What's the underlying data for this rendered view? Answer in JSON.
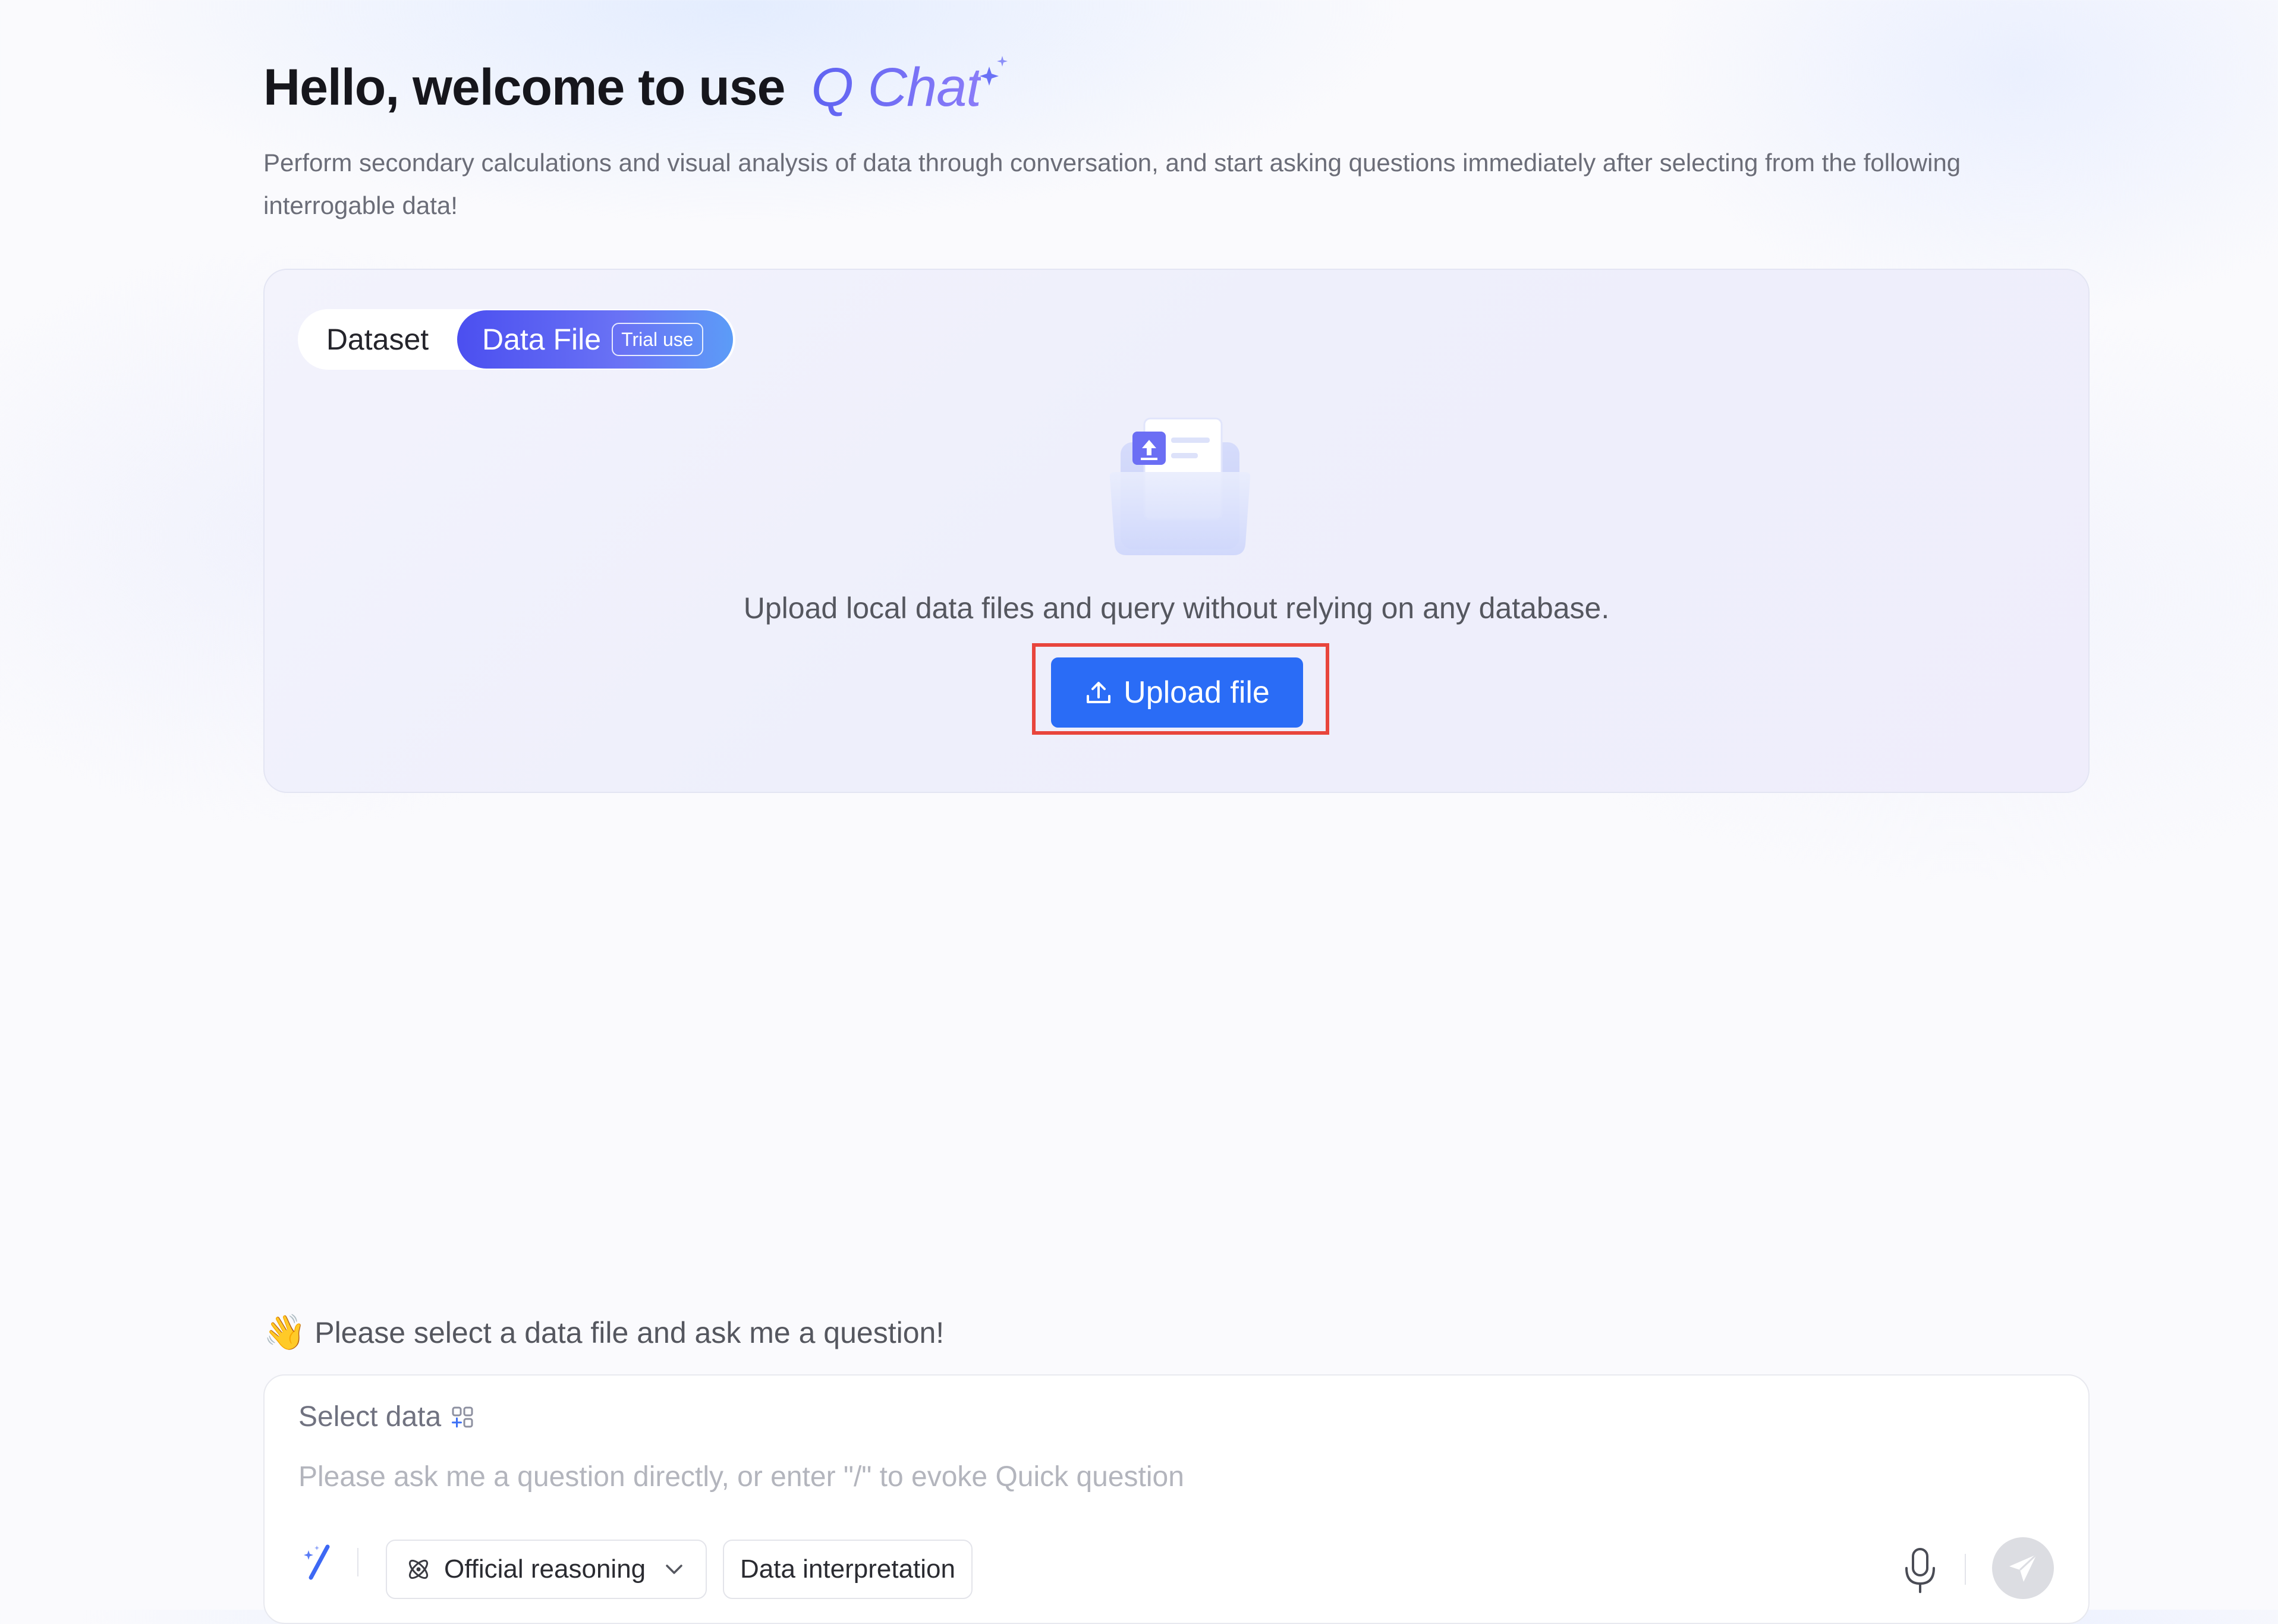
{
  "header": {
    "title": "Hello, welcome to use",
    "brand": "Q Chat",
    "subtitle": "Perform secondary calculations and visual analysis of data through conversation, and start asking questions immediately after selecting from the following interrogable data!"
  },
  "data_panel": {
    "tabs": [
      {
        "label": "Dataset",
        "active": false
      },
      {
        "label": "Data File",
        "active": true,
        "badge": "Trial use"
      }
    ],
    "description": "Upload local data files and query without relying on any database.",
    "upload_button_label": "Upload file",
    "icons": [
      "folder-upload-illustration",
      "upload-icon"
    ]
  },
  "composer": {
    "hint": "Please select a data file and ask me a question!",
    "hint_icon": "waving-hand",
    "select_data_label": "Select data",
    "select_data_icon": "grid-add-icon",
    "input_placeholder": "Please ask me a question directly, or enter \"/\" to evoke Quick question",
    "input_value": "",
    "reasoning_selected": "Official reasoning",
    "data_interpretation_label": "Data interpretation",
    "icons": [
      "magic-wand-icon",
      "atom-icon",
      "chevron-down-icon",
      "microphone-icon",
      "send-icon"
    ]
  },
  "colors": {
    "accent": "#2a6cf6",
    "brand_gradient_start": "#5e63f2",
    "brand_gradient_end": "#8a7cf8",
    "highlight_border": "#e8453c"
  }
}
